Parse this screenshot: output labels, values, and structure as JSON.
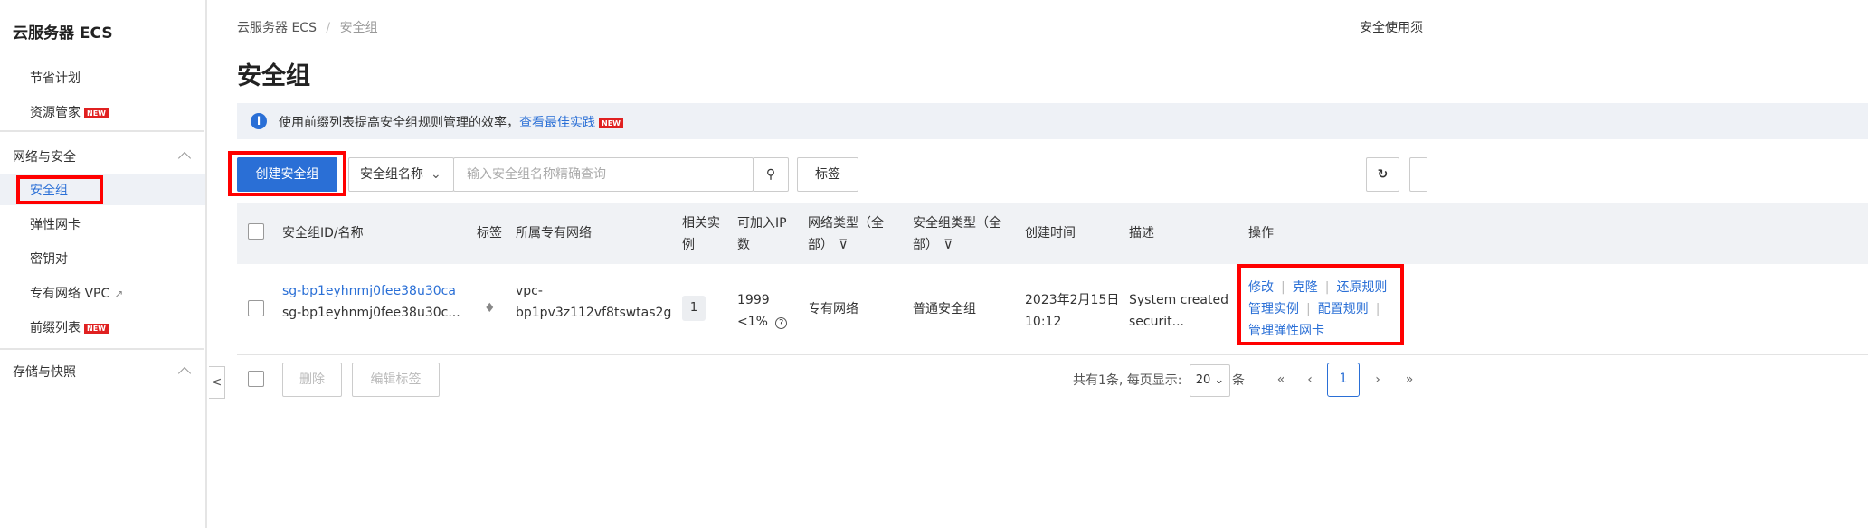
{
  "sidebar": {
    "title": "云服务器 ECS",
    "items_top": [
      {
        "label": "节省计划"
      },
      {
        "label": "资源管家",
        "badge": "NEW"
      }
    ],
    "group_network": "网络与安全",
    "network_items": [
      {
        "label": "安全组",
        "active": true
      },
      {
        "label": "弹性网卡"
      },
      {
        "label": "密钥对"
      },
      {
        "label": "专有网络 VPC",
        "icon": "external-link-icon"
      },
      {
        "label": "前缀列表",
        "badge": "NEW"
      }
    ],
    "group_storage": "存储与快照",
    "collapse": "<"
  },
  "breadcrumb": {
    "root": "云服务器 ECS",
    "sep": "/",
    "current": "安全组"
  },
  "page_title": "安全组",
  "top_right": "安全使用须",
  "notice": {
    "text": "使用前缀列表提高安全组规则管理的效率，",
    "link": "查看最佳实践",
    "badge": "NEW"
  },
  "toolbar": {
    "create": "创建安全组",
    "filter_select": "安全组名称",
    "search_placeholder": "输入安全组名称精确查询",
    "tag": "标签"
  },
  "table": {
    "headers": {
      "id": "安全组ID/名称",
      "tag": "标签",
      "vpc": "所属专有网络",
      "instances_1": "相关实",
      "instances_2": "例",
      "ip_1": "可加入IP",
      "ip_2": "数",
      "net_1": "网络类型（全",
      "net_2": "部）",
      "type_1": "安全组类型（全",
      "type_2": "部）",
      "created": "创建时间",
      "desc": "描述",
      "ops": "操作"
    },
    "rows": [
      {
        "id": "sg-bp1eyhnmj0fee38u30ca",
        "name": "sg-bp1eyhnmj0fee38u30c...",
        "vpc_1": "vpc-",
        "vpc_2": "bp1pv3z112vf8tswtas2g",
        "instances": "1",
        "ip_count": "1999",
        "ip_pct": "<1%",
        "net_type": "专有网络",
        "sg_type": "普通安全组",
        "created_1": "2023年2月15日",
        "created_2": "10:12",
        "desc_1": "System created",
        "desc_2": "securit...",
        "ops": [
          "修改",
          "克隆",
          "还原规则",
          "管理实例",
          "配置规则",
          "管理弹性网卡"
        ]
      }
    ]
  },
  "footer": {
    "delete": "删除",
    "edit_tags": "编辑标签",
    "total": "共有1条, 每页显示:",
    "page_size": "20",
    "unit": "条",
    "current_page": "1"
  },
  "colors": {
    "primary": "#2a6fd6",
    "annotation": "#ff0000",
    "new_badge": "#e02020"
  }
}
